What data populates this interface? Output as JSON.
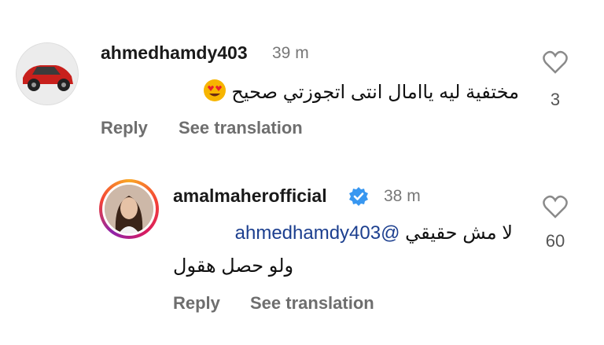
{
  "comments": [
    {
      "username": "ahmedhamdy403",
      "time": "39 m",
      "text": "مختفية ليه ياامال انتى اتجوزتي صحيح",
      "emoji_icon": "heart-eyes-emoji",
      "likes": "3",
      "reply_label": "Reply",
      "translate_label": "See translation"
    },
    {
      "username": "amalmaherofficial",
      "verified": true,
      "time": "38 m",
      "mention": "@ahmedhamdy403",
      "text_line1": "لا مش حقيقي",
      "text_line2": "ولو حصل هقول",
      "likes": "60",
      "reply_label": "Reply",
      "translate_label": "See translation"
    }
  ],
  "colors": {
    "verified": "#3897f0",
    "mention": "#1c3f8f",
    "muted": "#6e6e6e"
  }
}
